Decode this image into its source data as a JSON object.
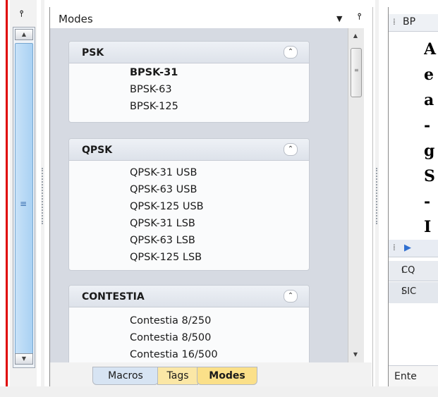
{
  "left_pane": {
    "pin": "⫯"
  },
  "modes_pane": {
    "title": "Modes",
    "dropdown": "▼",
    "pin": "⫯",
    "groups": [
      {
        "name": "PSK",
        "items": [
          "BPSK-31",
          "BPSK-63",
          "BPSK-125"
        ]
      },
      {
        "name": "QPSK",
        "items": [
          "QPSK-31 USB",
          "QPSK-63 USB",
          "QPSK-125 USB",
          "QPSK-31 LSB",
          "QPSK-63 LSB",
          "QPSK-125 LSB"
        ]
      },
      {
        "name": "CONTESTIA",
        "items": [
          "Contestia 8/250",
          "Contestia 8/500",
          "Contestia 16/500"
        ]
      }
    ],
    "selected_item": "BPSK-31",
    "tabs": [
      "Macros",
      "Tags",
      "Modes"
    ],
    "active_tab": "Modes"
  },
  "right_pane": {
    "header": "BP",
    "text_lines": [
      "A",
      "e",
      "a",
      "-",
      "g",
      "S",
      "-",
      "I"
    ],
    "lbl1": "CQ",
    "lbl2": "SIC",
    "bottom": "Ente"
  }
}
